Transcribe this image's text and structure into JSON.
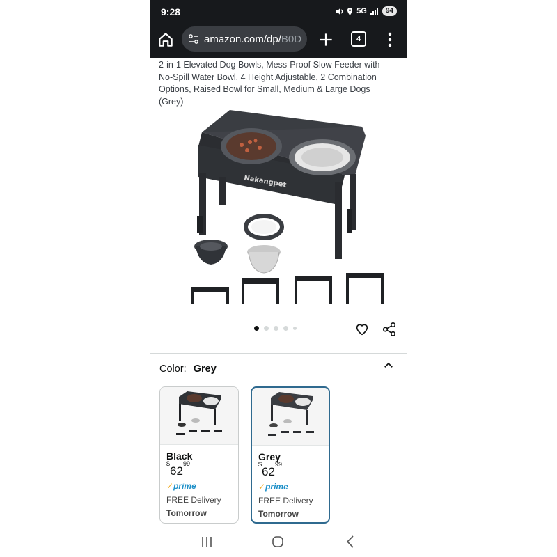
{
  "status_bar": {
    "time": "9:28",
    "network": "5G",
    "battery": "94"
  },
  "browser": {
    "url_visible": "amazon.com/dp/",
    "url_dim": "B0D",
    "tab_count": "4",
    "icons": [
      "home-icon",
      "site-settings-icon",
      "new-tab-icon",
      "tabs-icon",
      "more-menu-icon"
    ]
  },
  "product": {
    "title": "2-in-1 Elevated Dog Bowls, Mess-Proof Slow Feeder with No-Spill Water Bowl, 4 Height Adjustable, 2 Combination Options, Raised Bowl for Small, Medium & Large Dogs (Grey)",
    "brand_on_image": "Nakangpet",
    "image_count": 5,
    "image_index": 1
  },
  "color_selector": {
    "label": "Color:",
    "selected": "Grey",
    "options": [
      {
        "name": "Black",
        "price_symbol": "$",
        "price_whole": "62",
        "price_fraction": "99",
        "prime": "prime",
        "delivery": "FREE Delivery",
        "when": "Tomorrow"
      },
      {
        "name": "Grey",
        "price_symbol": "$",
        "price_whole": "62",
        "price_fraction": "99",
        "prime": "prime",
        "delivery": "FREE Delivery",
        "when": "Tomorrow"
      }
    ]
  },
  "colors": {
    "accent_selected": "#2f6a8f",
    "prime": "#1e90c8",
    "prime_check": "#f0a81c",
    "topbar": "#17191c"
  }
}
